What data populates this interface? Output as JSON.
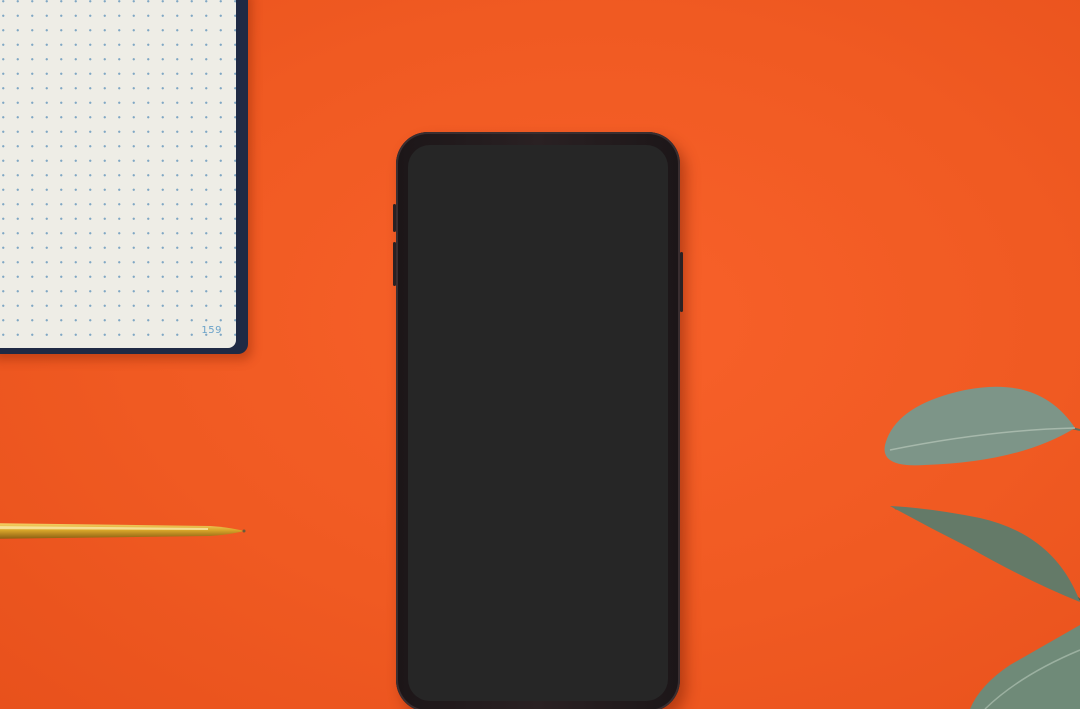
{
  "scene": {
    "background_color": "#f05a22",
    "objects": [
      {
        "name": "notebook",
        "page_color": "#eeede6",
        "cover_color": "#1f2a44"
      },
      {
        "name": "pen",
        "color": "#d9a62a"
      },
      {
        "name": "smartphone",
        "body_color": "#1c1618",
        "screen_color": "#262626"
      },
      {
        "name": "plant",
        "leaf_color": "#7d9588"
      }
    ]
  },
  "notebook": {
    "page_number": "159"
  }
}
